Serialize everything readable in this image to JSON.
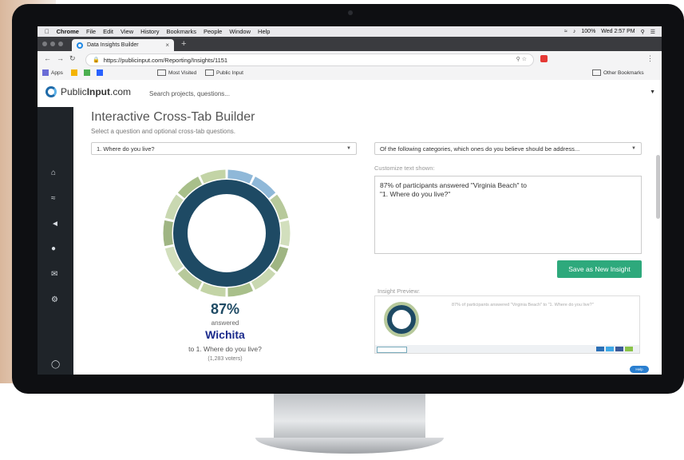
{
  "mac_menu": {
    "apple": "",
    "items": [
      "Chrome",
      "File",
      "Edit",
      "View",
      "History",
      "Bookmarks",
      "People",
      "Window",
      "Help"
    ],
    "battery": "100%",
    "clock": "Wed 2:57 PM"
  },
  "browser": {
    "tab_title": "Data Insights Builder",
    "url": "https://publicinput.com/Reporting/Insights/1151",
    "bookmarks": [
      "Apps",
      "Most Visited",
      "Public Input"
    ],
    "other_bookmarks": "Other Bookmarks"
  },
  "app": {
    "logo_prefix": "Public",
    "logo_bold": "Input",
    "logo_suffix": ".com",
    "search_placeholder": "Search projects, questions..."
  },
  "sidebar": {
    "icons": [
      "home-icon",
      "chart-icon",
      "megaphone-icon",
      "users-icon",
      "mail-icon",
      "gear-icon",
      "help-icon"
    ]
  },
  "builder": {
    "title": "Interactive Cross-Tab Builder",
    "subtitle": "Select a question and optional cross-tab questions.",
    "question_select": "1. Where do you live?",
    "crosstab_select": "Of the following categories, which ones do you believe should be address...",
    "customize_label": "Customize text shown:",
    "custom_text_line1": "87% of participants answered \"Virginia Beach\" to",
    "custom_text_line2": "\"1.   Where do you live?\"",
    "save_button": "Save as New Insight",
    "preview_label": "Insight Preview:",
    "preview_text": "87% of participants answered \"Virginia Beach\" to \"1. Where do you live?\""
  },
  "result": {
    "percent": "87%",
    "answered": "answered",
    "city": "Wichita",
    "question": "to 1. Where do you live?",
    "voters": "(1,283 voters)"
  },
  "help_badge": "Help",
  "colors": {
    "donut_main": "#1e4a64",
    "donut_outer": [
      "#a8bf8a",
      "#c3d4a6",
      "#b7c99b",
      "#d2dfbd",
      "#9fb583",
      "#c9d8b1"
    ],
    "save_green": "#2ea97c",
    "city_blue": "#1a2a8c",
    "sidebar": "#1f2429"
  }
}
